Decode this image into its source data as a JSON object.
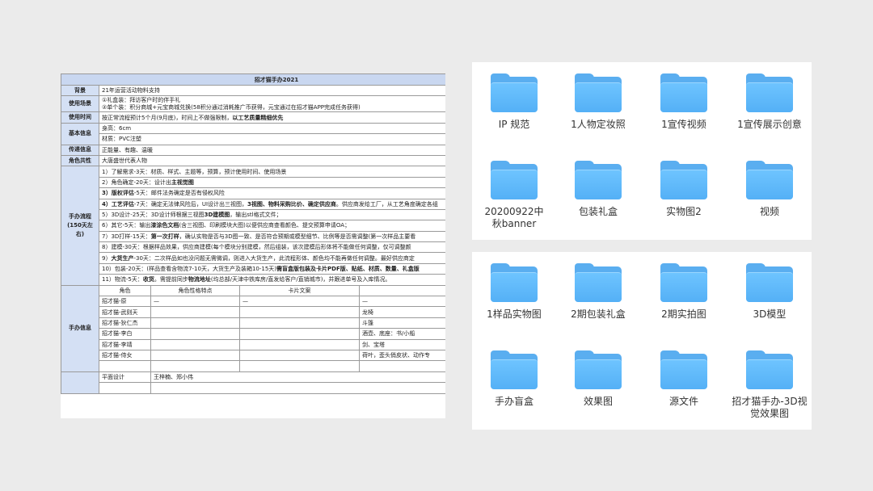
{
  "sheet": {
    "title": "招才猫手办2021",
    "rows": [
      {
        "label": "背景",
        "text": "21年运营活动物料支持"
      },
      {
        "label": "使用场景",
        "lines": [
          "①礼盒装：拜访客户时的伴手礼",
          "②单个装：积分商城+元宝商城兑换(58积分通过消耗推广币获得，元宝通过在招才猫APP完成任务获得)"
        ]
      },
      {
        "label": "使用时间",
        "text": "按正常流程预计5个月(9月底)，时间上不做强限制，",
        "bold": "以工艺质量精细优先"
      },
      {
        "label": "基本信息",
        "lines": [
          "身高：6cm",
          "材质：PVC注塑"
        ]
      },
      {
        "label": "传递信息",
        "text": "正能量、有趣、温暖"
      },
      {
        "label": "角色共性",
        "text": "大唐盛世代表人物"
      }
    ],
    "process_label": "手办流程\n(150天左右)",
    "process": [
      {
        "a": "1）了解需求-3天：材质、样式、主题等，预算，预计使用时间、使用场景"
      },
      {
        "a": "2）角色确定-20天：设计出",
        "b": "主视觉图"
      },
      {
        "b": "3）版权评估",
        "a": "-5天：邮件法务确定是否有侵权风险"
      },
      {
        "b": "4）工艺评估",
        "a": "-7天：确定无法律风险后，UI设计出三视图，",
        "c": "3视图、物料采购比价、确定供应商",
        "d": "。供应商发给工厂，从工艺角度确定各组"
      },
      {
        "a": "5）3D设计-25天：3D设计师根据三视图",
        "b": "3D建模图",
        "c": "，输出stl格式文件；"
      },
      {
        "a": "6）其它-5天：输出",
        "b": "漆涂色文档",
        "c": "(含三视图、印刷模块大图)以便供应商查看颜色、提交预算申请OA；"
      },
      {
        "a": "7）3D打样-15天：",
        "b": "第一次打样",
        "c": "，确认实物是否与3D图一致、是否符合预期或模型细节、比例等是否需调整(第一次样品主要看"
      },
      {
        "a": "8）建模-30天：根据样品效果，供应商建模(每个模块分别建模，然后组装，该次建模后形体将不能做任何调整，仅可调整颜"
      },
      {
        "a": "9）",
        "b": "大货生产",
        "c": "-30天：二次样品如也没问题无需微调，则进入大货生产，此流程形体、颜色均不能再做任何调整。最好供应商定"
      },
      {
        "a": "10）包装-20天：(样品查看含物流7-10天，大货生产及装箱10-15天)",
        "b": "需盲盒版包装及卡片PDF版、贴纸、材质、数量、礼盒版"
      },
      {
        "a": "11）物流-5天：",
        "b": "收货",
        "c": "。需提前同步",
        "d": "物流地址",
        "e": "(均总部/天津中铁库房/直发给客户/直销城市)，并跟进单号及入库情况。"
      }
    ],
    "figure_label": "手办信息",
    "figure_headers": [
      "角色",
      "角色性格特点",
      "卡片文案",
      ""
    ],
    "figures": [
      {
        "name": "招才猫-原",
        "c1": "—",
        "c2": "—",
        "c3": "—"
      },
      {
        "name": "招才猫-武则天",
        "c1": "",
        "c2": "",
        "c3": "龙椅"
      },
      {
        "name": "招才猫-狄仁杰",
        "c1": "",
        "c2": "",
        "c3": "斗篷"
      },
      {
        "name": "招才猫-李白",
        "c1": "",
        "c2": "",
        "c3": "酒壶、底座：书/小船"
      },
      {
        "name": "招才猫-李靖",
        "c1": "",
        "c2": "",
        "c3": "剑、宝塔"
      },
      {
        "name": "招才猫-侍女",
        "c1": "",
        "c2": "",
        "c3": "荷叶，歪头俏皮状、动作专"
      }
    ],
    "design": {
      "role": "平面设计",
      "people": "王梓楠、郑小伟"
    }
  },
  "finder_top": [
    {
      "label": "IP 规范",
      "icon": "folder-icon"
    },
    {
      "label": "1人物定妆照",
      "icon": "folder-icon"
    },
    {
      "label": "1宣传视频",
      "icon": "folder-icon"
    },
    {
      "label": "1宣传展示创意",
      "icon": "folder-icon"
    },
    {
      "label": "20200922中秋banner",
      "icon": "folder-icon"
    },
    {
      "label": "包装礼盒",
      "icon": "folder-icon"
    },
    {
      "label": "实物图2",
      "icon": "folder-icon"
    },
    {
      "label": "视频",
      "icon": "folder-icon"
    }
  ],
  "finder_bottom": [
    {
      "label": "1样品实物图",
      "icon": "folder-icon"
    },
    {
      "label": "2期包装礼盒",
      "icon": "folder-icon"
    },
    {
      "label": "2期实拍图",
      "icon": "folder-icon"
    },
    {
      "label": "3D模型",
      "icon": "folder-icon"
    },
    {
      "label": "手办盲盒",
      "icon": "folder-icon"
    },
    {
      "label": "效果图",
      "icon": "folder-icon"
    },
    {
      "label": "源文件",
      "icon": "folder-icon"
    },
    {
      "label": "招才猫手办-3D视觉效果图",
      "icon": "folder-icon"
    }
  ],
  "colors": {
    "folder": "#5aaef0",
    "header": "#c9d7f0",
    "label_cell": "#d4e0f4"
  }
}
